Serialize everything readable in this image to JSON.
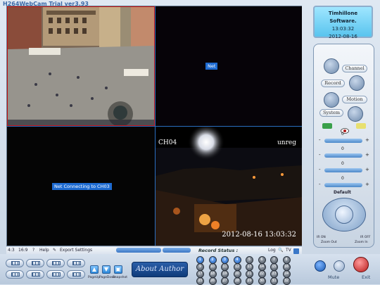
{
  "app": {
    "title": "H264WebCam Trial ver3.93"
  },
  "info": {
    "company": "Timhillone Software.",
    "time": "13:03:32",
    "date": "2012-08-16"
  },
  "video": {
    "cell2_badge": "Net",
    "cell3_badge": "Net Connecting to CH03",
    "cell4_channel": "CH04",
    "cell4_watermark": "unreg",
    "cell4_timestamp": "2012-08-16 13:03:32"
  },
  "bottom_bar": {
    "ratio_43": "4:3",
    "ratio_169": "16:9",
    "help": "Help",
    "export": "Export Settings",
    "record_status": "Record Status :",
    "log": "Log",
    "tv": "TV"
  },
  "toolbar": {
    "pageup": "PageUp",
    "pagedown": "PageDown",
    "snapshot": "Snapshot",
    "about": "About Author",
    "mute": "Mute",
    "exit": "Exit",
    "channels": [
      "1",
      "2",
      "3",
      "4",
      "5",
      "6",
      "7",
      "8",
      "9",
      "10",
      "11",
      "12",
      "13",
      "14",
      "15",
      "16",
      "17",
      "18",
      "19",
      "20",
      "21",
      "22",
      "23",
      "24",
      "25",
      "26",
      "27",
      "28",
      "29",
      "30",
      "31",
      "32"
    ]
  },
  "controls": {
    "channel": "Channel",
    "record": "Record",
    "motion": "Motion",
    "system": "System",
    "sliders": [
      "0",
      "0",
      "0",
      "0"
    ],
    "default": "Default",
    "ir_on": "IR ON",
    "ir_off": "IR OFF",
    "zoom_out": "Zoom Out",
    "zoom_in": "Zoom In"
  },
  "colors": {
    "accent": "#1e6bd1",
    "active_border": "#c01010"
  }
}
